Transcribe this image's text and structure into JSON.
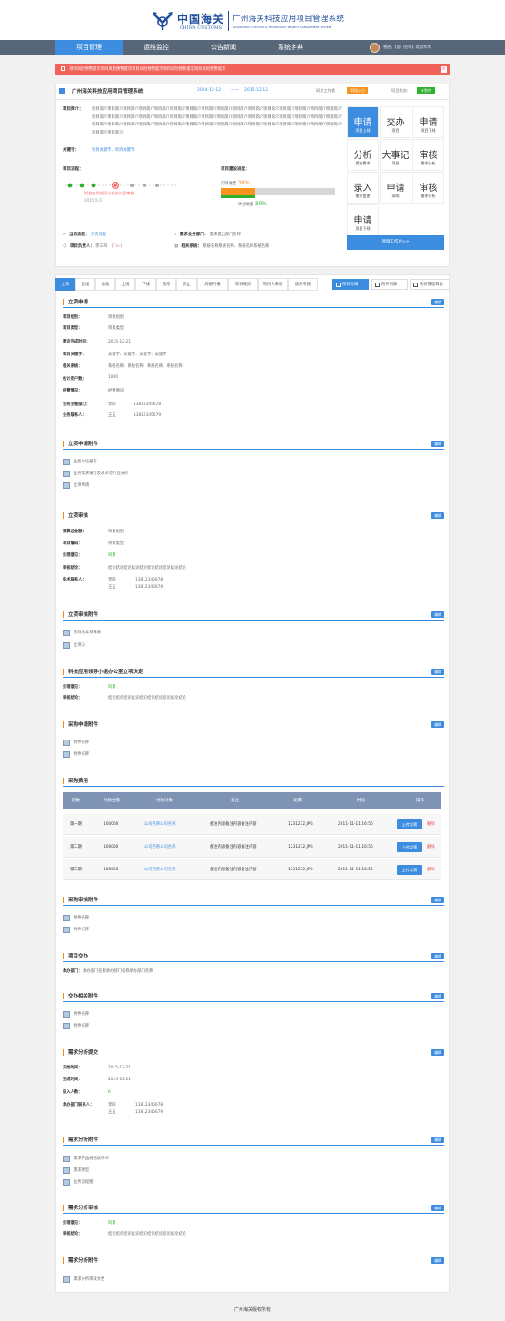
{
  "header": {
    "logo_cn": "中国海关",
    "logo_en": "CHINA CUSTOMS",
    "system_title": "广州海关科技应用项目管理系统",
    "system_sub": "GUANGZHOU CUSTOMS & TECHNOLOGY PROJECT MANAGEMENT SYSTEM"
  },
  "nav": {
    "items": [
      "项目管理",
      "运维监控",
      "公告新闻",
      "系统字典"
    ],
    "user": "曾经，【部门名称】欢迎木木"
  },
  "alert": {
    "text": "项目风险预警提示项目风险预警提示项目风险预警提示项目风险预警提示项目风险预警提示"
  },
  "project": {
    "title": "广州海关科技应用项目管理系统",
    "start": "2014-12-12",
    "dash": "——",
    "end": "2015-12-12",
    "workload_label": "研发工作量",
    "workload": "13投入日",
    "status_label": "项目状态：",
    "status": "计划中",
    "intro_label": "项目简介：",
    "intro": "项目简介项目简介项目简介项目简介项目简介项目简介项目简介项目简介项目简介项目简介项目简介项目简介项目简介项目简介项目简介项目简介项目简介项目简介项目简介项目简介项目简介项目简介项目简介项目简介项目简介项目简介项目简介项目简介项目简介项目简介项目简介项目简介项目简介项目简介项目简介项目简介项目简介项目简介项目简介项目简介项目简介项目简介项目简介项目简介项目简介项目简介项目简介项目简介项目简介项目简介",
    "keywords_label": "关键字：",
    "keywords": "项目关键字、项目关键字",
    "flow_label": "项目流程：",
    "flow_current": "科技应用领导小组办公室审批",
    "flow_date": "2015-5-5",
    "progress_label": "项目建设进度：",
    "actual_label": "实际进度",
    "actual": "30%",
    "plan_label": "计划进度",
    "plan": "30%",
    "current_flow_label": "当前流程：",
    "current_flow": "负责流程",
    "dept_label": "需求业务部门：",
    "dept": "需求提出部门名称",
    "owner_label": "项目负责人：",
    "owner": "李三四",
    "owner_count": "(7",
    "related_label": "相关系统：",
    "related": "系统名称系统名称、系统名称系统名称"
  },
  "grid": [
    {
      "b": "申请",
      "s": "项目上线"
    },
    {
      "b": "交办",
      "s": "项目"
    },
    {
      "b": "申请",
      "s": "项目下线"
    },
    {
      "b": "分析",
      "s": "提交需求"
    },
    {
      "b": "大事记",
      "s": "项目"
    },
    {
      "b": "审核",
      "s": "需求分析"
    },
    {
      "b": "录入",
      "s": "需求变更"
    },
    {
      "b": "申请",
      "s": "采购"
    },
    {
      "b": "审核",
      "s": "需求分析"
    },
    {
      "b": "申请",
      "s": "项目下线"
    }
  ],
  "workbench": "项目工作台>>",
  "tabs": [
    "立项",
    "建设",
    "验收",
    "上线",
    "下线",
    "暂停",
    "作止",
    "周报月报",
    "项目成员",
    "项目大事记",
    "绩效考核"
  ],
  "tab_buttons": [
    "项目协调",
    "附件列表",
    "项目管理日志"
  ],
  "edit": "编辑",
  "s1": {
    "title": "立项申请",
    "rows": [
      [
        "项目组别：",
        "项目组别"
      ],
      [
        "项目类型：",
        "项目类型"
      ],
      [
        "建议完成时间：",
        "2015-12-21"
      ],
      [
        "项目关键字：",
        "关键字、关键字、关键字、关键字"
      ],
      [
        "相关系统：",
        "系统名称、系统名称、系统名称、系统名称"
      ],
      [
        "估计用户数：",
        "1000"
      ],
      [
        "经费情况：",
        "经费情况"
      ]
    ],
    "mgr_label": "业务主管部门：",
    "mgr_name": "李四",
    "mgr_phone": "13812345678",
    "contact_label": "业务联系人：",
    "contact_name": "王五",
    "contact_phone": "13812345679"
  },
  "s2": {
    "title": "立项申请附件",
    "files": [
      "业务论证报告",
      "业务需求报告及技术可行性分析",
      "立项申请"
    ]
  },
  "s3": {
    "title": "立项审核",
    "rows": [
      [
        "预算总金额：",
        "项目组别"
      ],
      [
        "项目编码：",
        "项目类型"
      ],
      [
        "处理意见：",
        "同意"
      ],
      [
        "审核结论：",
        "结论结论结论结论结论结论结论结论结论结论"
      ]
    ],
    "tech_label": "技术联系人：",
    "tech1": "李四",
    "tech1_phone": "13812345678",
    "tech2": "王五",
    "tech2_phone": "13812345679"
  },
  "s4": {
    "title": "立项审核附件",
    "files": [
      "项目成本预算表",
      "立项决"
    ]
  },
  "s5": {
    "title": "科技应用领导小组办公室立项决定",
    "rows": [
      [
        "处理意见：",
        "同意"
      ],
      [
        "审核结论：",
        "结论结论结论结论结论结论结论结论结论结论"
      ]
    ]
  },
  "s6": {
    "title": "采购申请附件",
    "files": [
      "附件名称",
      "附件名称"
    ]
  },
  "s7": {
    "title": "采购费用",
    "headers": [
      "期数",
      "付款金额",
      "付款对象",
      "备注",
      "发票",
      "时间",
      "操作"
    ],
    "rows": [
      [
        "第一期",
        "100000",
        "公司名称公司名称",
        "备注内容备注内容备注内容",
        "1231232.JPG",
        "2011-11-11  16:56",
        "上传发票",
        "删除"
      ],
      [
        "第二期",
        "100000",
        "公司名称公司名称",
        "备注内容备注内容备注内容",
        "1231232.JPG",
        "2011-11-11  16:56",
        "上传发票",
        "删除"
      ],
      [
        "第三期",
        "100000",
        "公司名称公司名称",
        "备注内容备注内容备注内容",
        "1231232.JPG",
        "2011-11-11  16:56",
        "上传发票",
        "删除"
      ]
    ]
  },
  "s8": {
    "title": "采购审核附件",
    "files": [
      "附件名称",
      "附件名称"
    ]
  },
  "s9": {
    "title": "项目交办",
    "label": "承办部门：",
    "value": "承办部门名称承办部门名称承办部门名称"
  },
  "s10": {
    "title": "交办相关附件",
    "files": [
      "附件名称",
      "附件名称"
    ]
  },
  "s11": {
    "title": "需求分析提交",
    "rows": [
      [
        "开始时间：",
        "2015-12-21"
      ],
      [
        "完成时间：",
        "2015-12-21"
      ],
      [
        "投入人数：",
        "6"
      ]
    ],
    "contact_label": "承办部门联系人：",
    "c1": "李四",
    "c1p": "13812345678",
    "c2": "王五",
    "c2p": "13812345679"
  },
  "s12": {
    "title": "需求分析附件",
    "files": [
      "需求产品规格说明书",
      "需求原型",
      "业务流程图"
    ]
  },
  "s13": {
    "title": "需求分析审核",
    "rows": [
      [
        "处理意见：",
        "同意"
      ],
      [
        "审核结论：",
        "结论结论结论结论结论结论结论结论结论结论"
      ]
    ]
  },
  "s14": {
    "title": "需求分析附件",
    "files": [
      "需求分析审核文档"
    ]
  },
  "footer": "广州海关版权所有"
}
